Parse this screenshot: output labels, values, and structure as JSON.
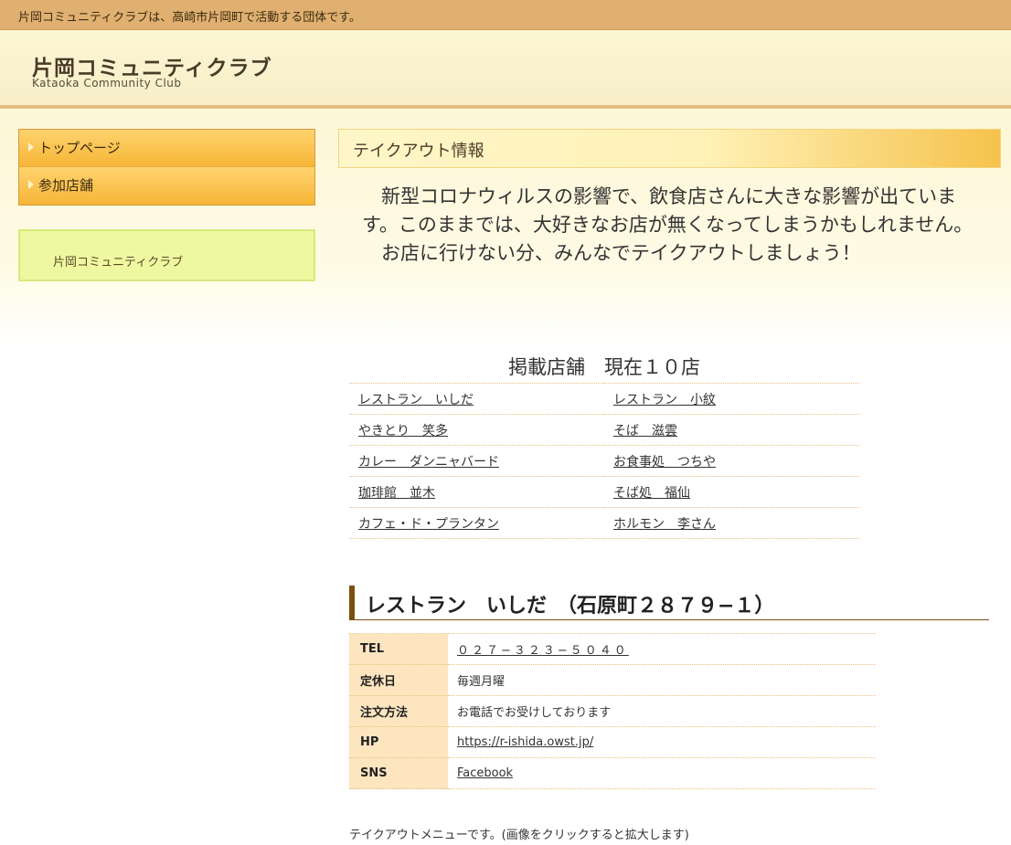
{
  "topbar": {
    "text": "片岡コミュニティクラブは、高崎市片岡町で活動する団体です。"
  },
  "header": {
    "title": "片岡コミュニティクラブ",
    "subtitle": "Kataoka Community Club"
  },
  "nav": {
    "items": [
      {
        "label": "トップページ"
      },
      {
        "label": "参加店舗"
      }
    ]
  },
  "sidebar_box": {
    "text": "片岡コミュニティクラブ"
  },
  "main": {
    "heading": "テイクアウト情報",
    "intro_line1": "　新型コロナウィルスの影響で、飲食店さんに大きな影響が出ています。このままでは、大好きなお店が無くなってしまうかもしれません。",
    "intro_line2": "　お店に行けない分、みんなでテイクアウトしましょう！"
  },
  "shops": {
    "title": "掲載店舗　現在１０店",
    "rows": [
      [
        "レストラン　いしだ",
        "レストラン　小紋"
      ],
      [
        "やきとり　笑多",
        "そば　滋雲"
      ],
      [
        "カレー　ダンニャバード",
        "お食事処　つちや"
      ],
      [
        "珈琲館　並木",
        "そば処　福仙"
      ],
      [
        "カフェ・ド・プランタン",
        "ホルモン　李さん"
      ]
    ]
  },
  "store": {
    "heading": "レストラン　いしだ　（石原町２８７９−１）",
    "info": [
      {
        "key": "TEL",
        "value": "０２７−３２３−５０４０",
        "link": true
      },
      {
        "key": "定休日",
        "value": "毎週月曜",
        "link": false
      },
      {
        "key": "注文方法",
        "value": "お電話でお受けしております",
        "link": false
      },
      {
        "key": "HP",
        "value": "https://r-ishida.owst.jp/",
        "link": true
      },
      {
        "key": "SNS",
        "value": "Facebook",
        "link": true
      }
    ],
    "menu_note": "テイクアウトメニューです。(画像をクリックすると拡大します)"
  }
}
